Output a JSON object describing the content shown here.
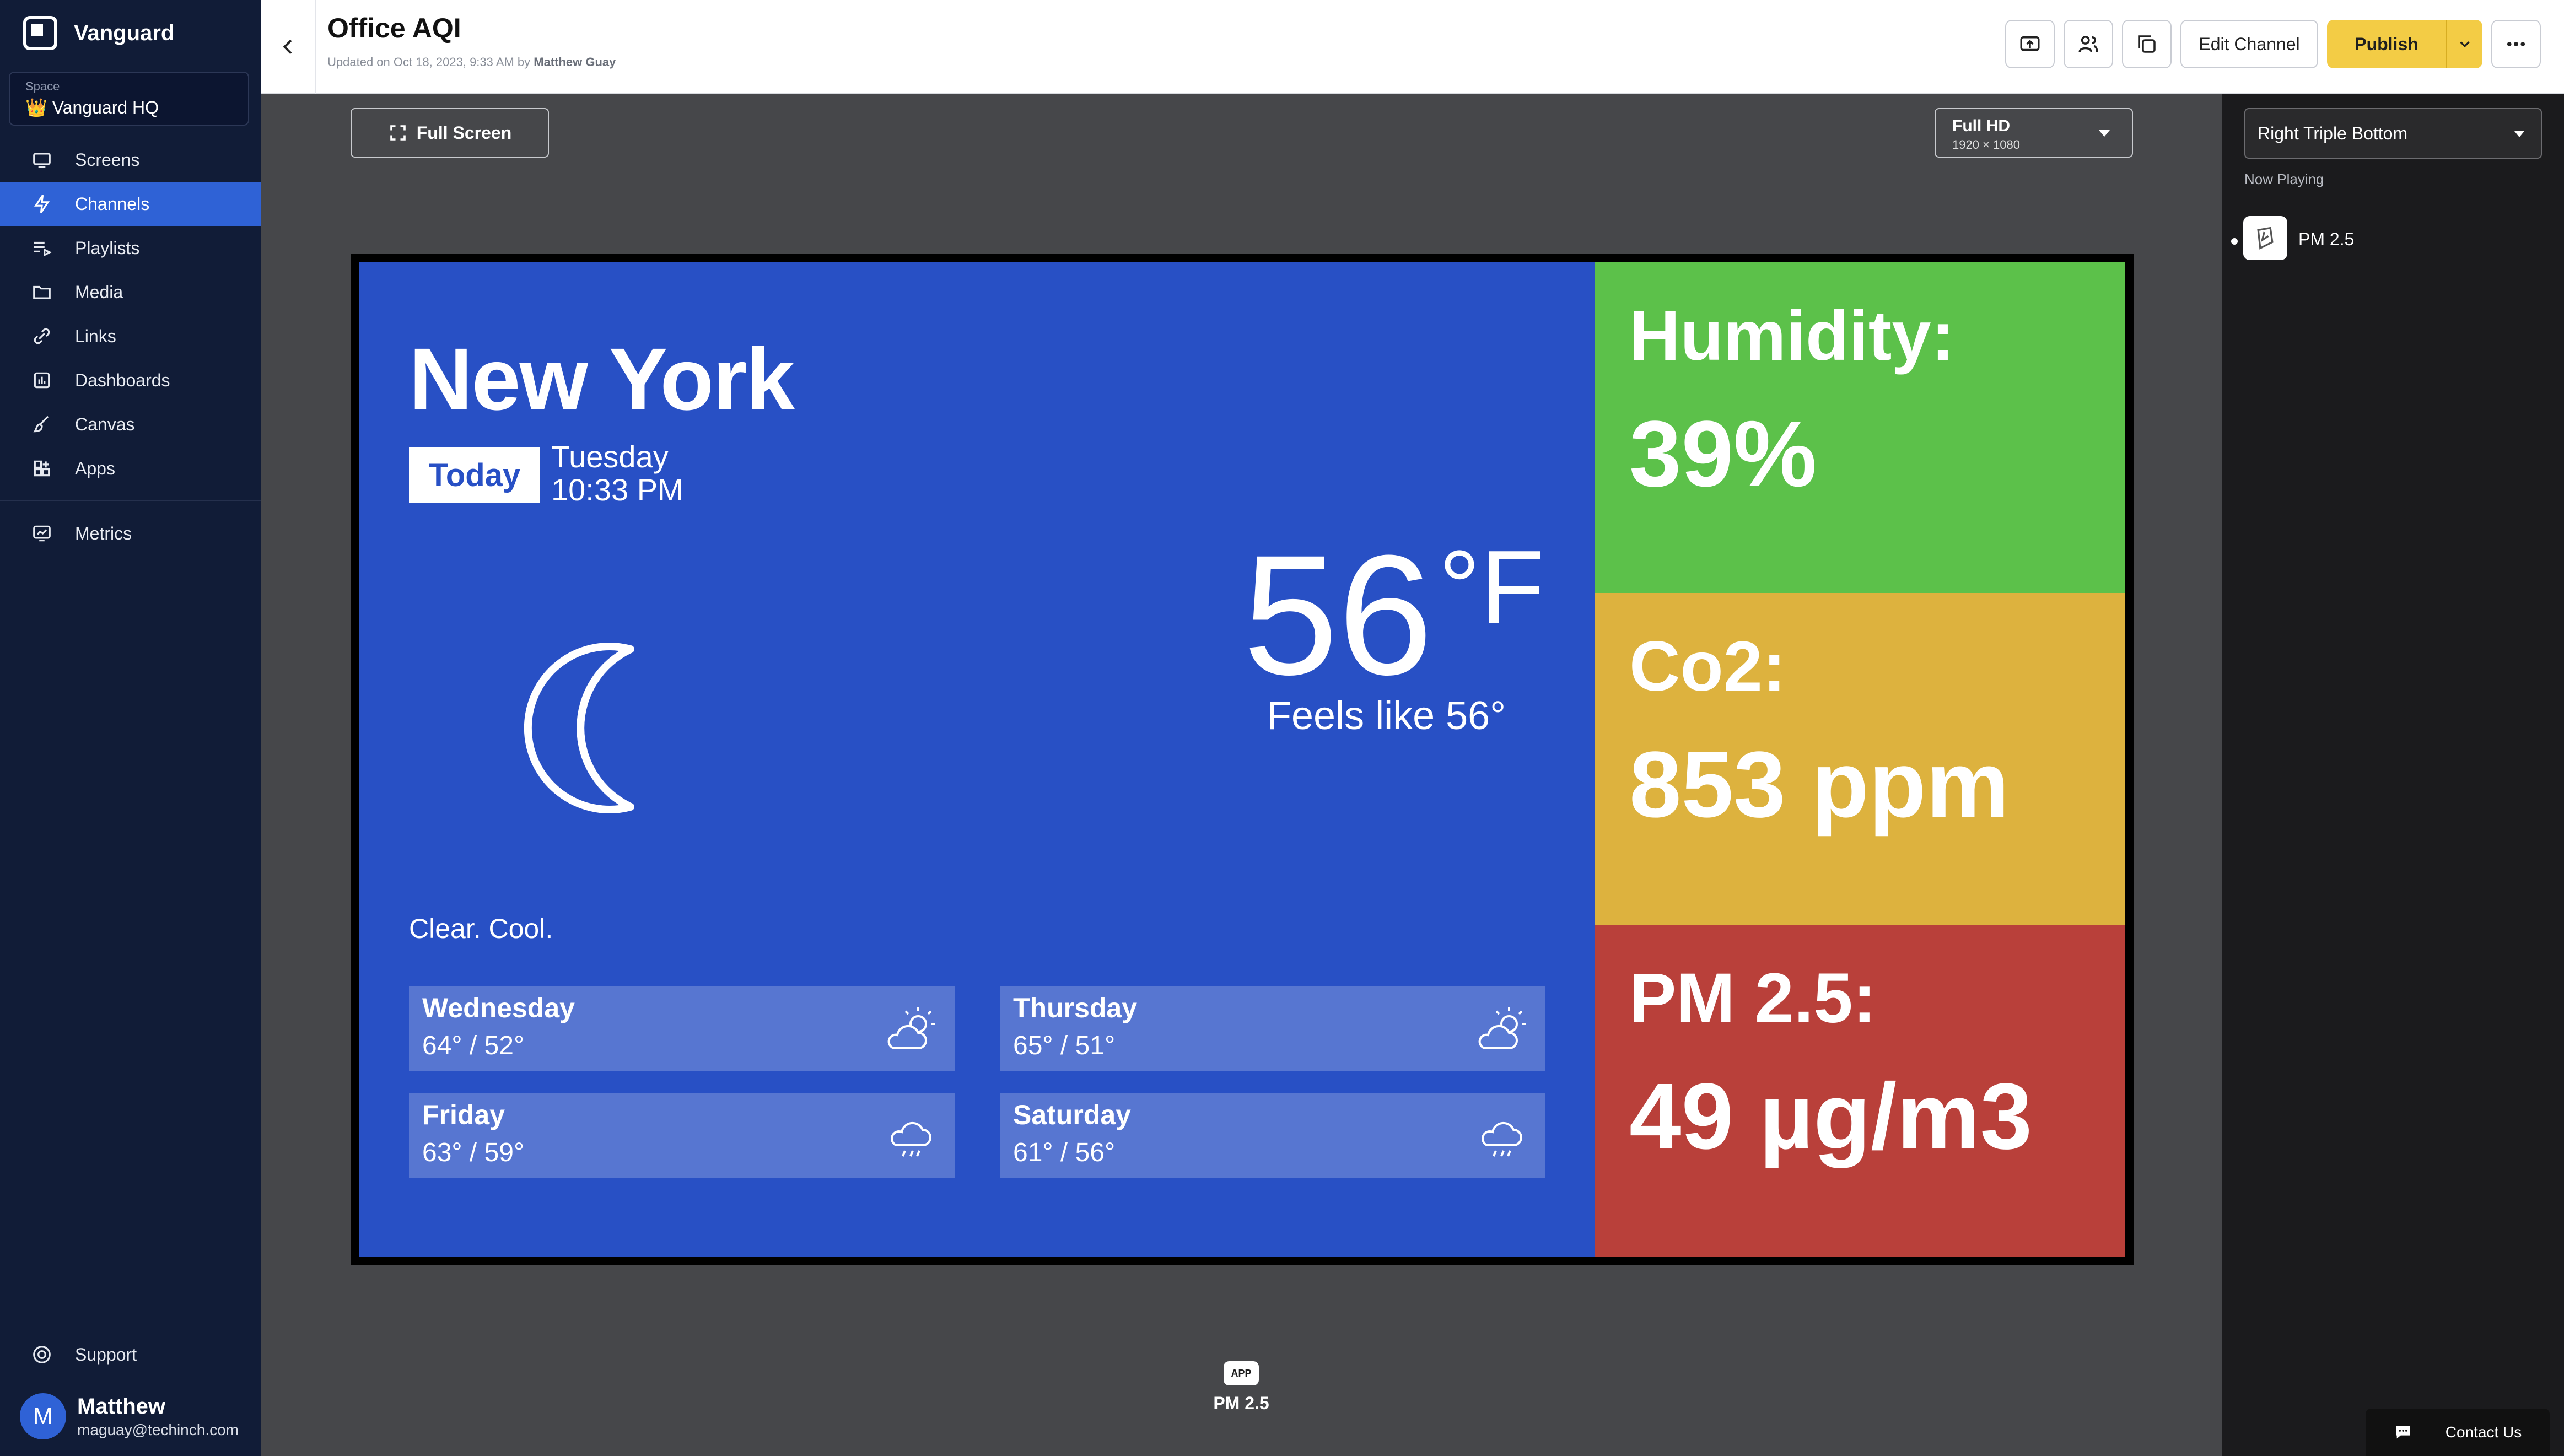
{
  "sidebar": {
    "brand": "Vanguard",
    "space_label": "Space",
    "space_name": "👑 Vanguard HQ",
    "items": [
      {
        "label": "Screens",
        "icon": "screen-icon"
      },
      {
        "label": "Channels",
        "icon": "lightning-icon",
        "active": true
      },
      {
        "label": "Playlists",
        "icon": "playlist-icon"
      },
      {
        "label": "Media",
        "icon": "folder-icon"
      },
      {
        "label": "Links",
        "icon": "link-icon"
      },
      {
        "label": "Dashboards",
        "icon": "dashboard-icon"
      },
      {
        "label": "Canvas",
        "icon": "brush-icon"
      },
      {
        "label": "Apps",
        "icon": "apps-icon"
      }
    ],
    "metrics": "Metrics",
    "support": "Support",
    "user": {
      "initial": "M",
      "name": "Matthew",
      "email": "maguay@techinch.com"
    }
  },
  "header": {
    "title": "Office AQI",
    "updated_prefix": "Updated on Oct 18, 2023, 9:33 AM by ",
    "updated_by": "Matthew Guay",
    "edit_channel": "Edit Channel",
    "publish": "Publish"
  },
  "toolbar": {
    "full_screen": "Full Screen",
    "resolution_name": "Full HD",
    "resolution_dims": "1920 × 1080"
  },
  "weather": {
    "city": "New York",
    "today": "Today",
    "day": "Tuesday",
    "time": "10:33 PM",
    "temp": "56",
    "unit": "°F",
    "feels": "Feels like 56°",
    "condition": "Clear. Cool.",
    "forecast": [
      {
        "day": "Wednesday",
        "temps": "64° / 52°",
        "icon": "partly-cloudy-icon"
      },
      {
        "day": "Thursday",
        "temps": "65° / 51°",
        "icon": "partly-cloudy-icon"
      },
      {
        "day": "Friday",
        "temps": "63° / 59°",
        "icon": "rain-cloud-icon"
      },
      {
        "day": "Saturday",
        "temps": "61° / 56°",
        "icon": "rain-cloud-icon"
      }
    ]
  },
  "aqi": {
    "humidity_label": "Humidity:",
    "humidity_value": "39%",
    "co2_label": "Co2:",
    "co2_value": "853 ppm",
    "pm_label": "PM 2.5:",
    "pm_value": "49 µg/m3"
  },
  "preview_footer": {
    "chip": "APP",
    "label": "PM 2.5"
  },
  "right_panel": {
    "layout": "Right Triple Bottom",
    "now_playing_label": "Now Playing",
    "now_playing_item": "PM 2.5"
  },
  "contact": "Contact Us",
  "colors": {
    "sidebar": "#111c37",
    "accent": "#2f62d6",
    "publish": "#f3cc45",
    "weather_bg": "#2850c5",
    "humidity_bg": "#5cc14a",
    "co2_bg": "#ddb23e",
    "pm_bg": "#b9403a"
  }
}
